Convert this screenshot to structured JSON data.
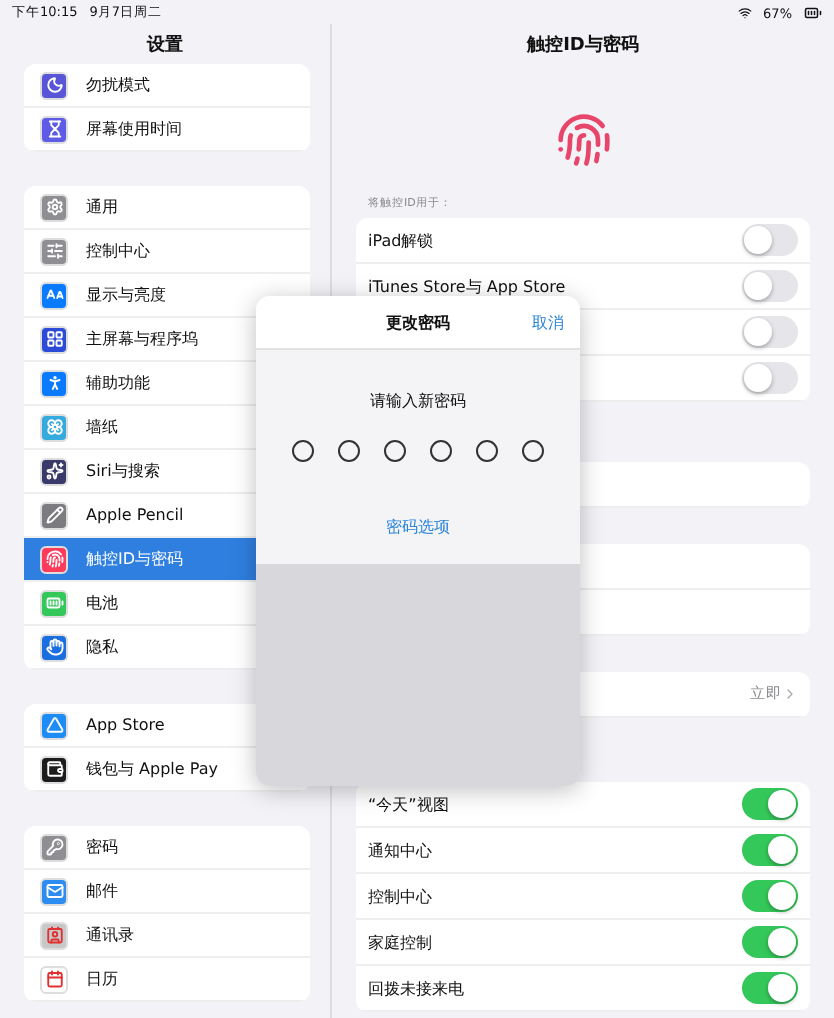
{
  "status_bar": {
    "time": "下午10:15",
    "date": "9月7日周二",
    "battery": "67%"
  },
  "sidebar": {
    "title": "设置",
    "groups": [
      [
        {
          "label": "勿扰模式",
          "color": "#5856d6",
          "selected": false
        },
        {
          "label": "屏幕使用时间",
          "color": "#5e5ce6",
          "selected": false
        }
      ],
      [
        {
          "label": "通用",
          "color": "#8e8e93",
          "selected": false
        },
        {
          "label": "控制中心",
          "color": "#8e8e93",
          "selected": false
        },
        {
          "label": "显示与亮度",
          "color": "#0a7aff",
          "selected": false
        },
        {
          "label": "主屏幕与程序坞",
          "color": "#2c4bd6",
          "selected": false
        },
        {
          "label": "辅助功能",
          "color": "#0a7aff",
          "selected": false
        },
        {
          "label": "墙纸",
          "color": "#35aadc",
          "selected": false
        },
        {
          "label": "Siri与搜索",
          "color": "#3a3a6a",
          "selected": false
        },
        {
          "label": "Apple Pencil",
          "color": "#7c7c80",
          "selected": false
        },
        {
          "label": "触控ID与密码",
          "color": "#ff3b5c",
          "selected": true
        },
        {
          "label": "电池",
          "color": "#34c759",
          "selected": false
        },
        {
          "label": "隐私",
          "color": "#1a6fe0",
          "selected": false
        }
      ],
      [
        {
          "label": "App Store",
          "color": "#1d8cf5",
          "selected": false
        },
        {
          "label": "钱包与 Apple Pay",
          "color": "#1c1c1e",
          "selected": false
        }
      ],
      [
        {
          "label": "密码",
          "color": "#8e8e93",
          "selected": false
        },
        {
          "label": "邮件",
          "color": "#2d8cf0",
          "selected": false
        },
        {
          "label": "通讯录",
          "color": "#c8c8c8",
          "selected": false
        },
        {
          "label": "日历",
          "color": "#ffffff",
          "selected": false
        }
      ]
    ]
  },
  "detail": {
    "title": "触控ID与密码",
    "section_header": "将触控ID用于：",
    "groups": [
      [
        {
          "kind": "toggle",
          "label": "iPad解锁",
          "on": false
        },
        {
          "kind": "toggle",
          "label": "iTunes Store与 App Store",
          "on": false
        },
        {
          "kind": "toggle",
          "on": false
        },
        {
          "kind": "toggle",
          "on": false
        }
      ],
      [
        {
          "kind": "plain"
        }
      ],
      [
        {
          "kind": "plain"
        },
        {
          "kind": "plain"
        }
      ],
      [
        {
          "kind": "value",
          "value": "立即"
        }
      ],
      [
        {
          "kind": "toggle",
          "label": "“今天”视图",
          "on": true
        },
        {
          "kind": "toggle",
          "label": "通知中心",
          "on": true
        },
        {
          "kind": "toggle",
          "label": "控制中心",
          "on": true
        },
        {
          "kind": "toggle",
          "label": "家庭控制",
          "on": true
        },
        {
          "kind": "toggle",
          "label": "回拨未接来电",
          "on": true
        }
      ]
    ]
  },
  "dialog": {
    "title": "更改密码",
    "cancel": "取消",
    "prompt": "请输入新密码",
    "slots": [
      {
        "filled": false
      },
      {
        "filled": false
      },
      {
        "filled": false
      },
      {
        "filled": false
      },
      {
        "filled": false
      },
      {
        "filled": false
      }
    ],
    "options_link": "密码选项"
  }
}
